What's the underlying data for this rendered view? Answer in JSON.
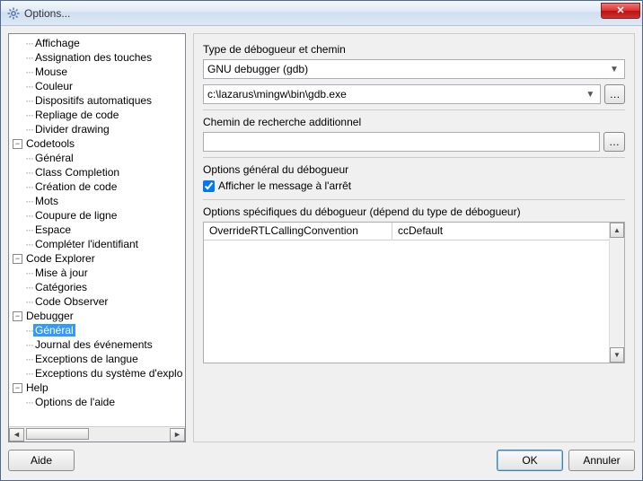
{
  "window": {
    "title": "Options..."
  },
  "tree": {
    "items": [
      {
        "depth": 2,
        "label": "Affichage",
        "leaf": true
      },
      {
        "depth": 2,
        "label": "Assignation des touches",
        "leaf": true
      },
      {
        "depth": 2,
        "label": "Mouse",
        "leaf": true
      },
      {
        "depth": 2,
        "label": "Couleur",
        "leaf": true
      },
      {
        "depth": 2,
        "label": "Dispositifs automatiques",
        "leaf": true
      },
      {
        "depth": 2,
        "label": "Repliage de code",
        "leaf": true
      },
      {
        "depth": 2,
        "label": "Divider drawing",
        "leaf": true
      },
      {
        "depth": 1,
        "label": "Codetools",
        "expanded": true
      },
      {
        "depth": 2,
        "label": "Général",
        "leaf": true
      },
      {
        "depth": 2,
        "label": "Class Completion",
        "leaf": true
      },
      {
        "depth": 2,
        "label": "Création de code",
        "leaf": true
      },
      {
        "depth": 2,
        "label": "Mots",
        "leaf": true
      },
      {
        "depth": 2,
        "label": "Coupure de ligne",
        "leaf": true
      },
      {
        "depth": 2,
        "label": "Espace",
        "leaf": true
      },
      {
        "depth": 2,
        "label": "Compléter l'identifiant",
        "leaf": true
      },
      {
        "depth": 1,
        "label": "Code Explorer",
        "expanded": true
      },
      {
        "depth": 2,
        "label": "Mise à jour",
        "leaf": true
      },
      {
        "depth": 2,
        "label": "Catégories",
        "leaf": true
      },
      {
        "depth": 2,
        "label": "Code Observer",
        "leaf": true
      },
      {
        "depth": 1,
        "label": "Debugger",
        "expanded": true
      },
      {
        "depth": 2,
        "label": "Général",
        "leaf": true,
        "selected": true
      },
      {
        "depth": 2,
        "label": "Journal des événements",
        "leaf": true
      },
      {
        "depth": 2,
        "label": "Exceptions de langue",
        "leaf": true
      },
      {
        "depth": 2,
        "label": "Exceptions du système d'explo",
        "leaf": true
      },
      {
        "depth": 1,
        "label": "Help",
        "expanded": true
      },
      {
        "depth": 2,
        "label": "Options de l'aide",
        "leaf": true
      }
    ]
  },
  "right": {
    "type_label": "Type de débogueur et chemin",
    "debugger_type": "GNU debugger (gdb)",
    "debugger_path": "c:\\lazarus\\mingw\\bin\\gdb.exe",
    "search_path_label": "Chemin de recherche additionnel",
    "search_path": "",
    "general_label": "Options général du débogueur",
    "show_stop_msg": "Afficher le message à l'arrêt",
    "show_stop_checked": true,
    "specific_label": "Options spécifiques du débogueur (dépend du type de débogueur)",
    "grid_col1": "OverrideRTLCallingConvention",
    "grid_col2": "ccDefault"
  },
  "footer": {
    "help": "Aide",
    "ok": "OK",
    "cancel": "Annuler"
  }
}
